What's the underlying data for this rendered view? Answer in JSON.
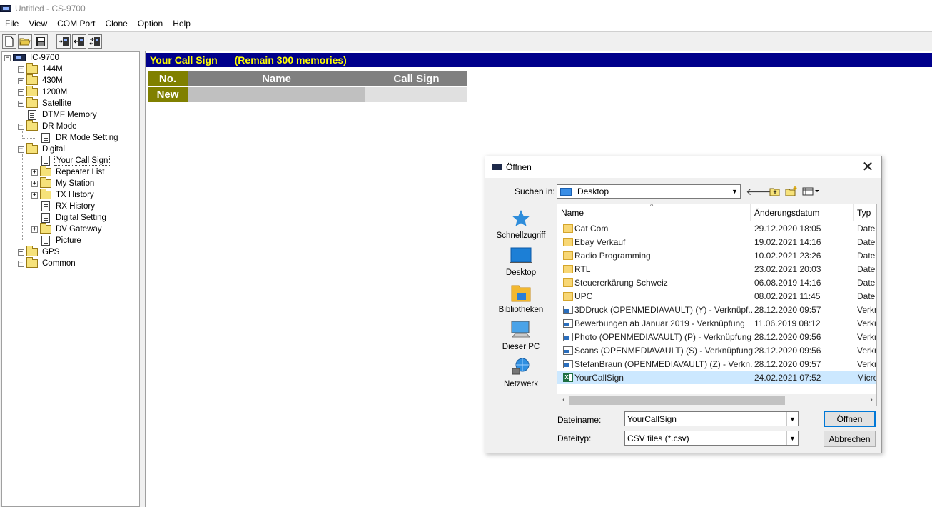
{
  "window": {
    "title": "Untitled - CS-9700"
  },
  "menu": [
    "File",
    "View",
    "COM Port",
    "Clone",
    "Option",
    "Help"
  ],
  "toolbar": {
    "buttons": [
      "new-file-icon",
      "open-folder-icon",
      "save-disk-icon",
      "write-to-radio-icon",
      "read-from-radio-icon",
      "clone-icon"
    ]
  },
  "tree": {
    "root": "IC-9700",
    "items": [
      "144M",
      "430M",
      "1200M",
      "Satellite",
      "DTMF Memory",
      "DR Mode",
      "DR Mode Setting",
      "Digital",
      "Your Call Sign",
      "Repeater List",
      "My Station",
      "TX History",
      "RX History",
      "Digital Setting",
      "DV Gateway",
      "Picture",
      "GPS",
      "Common"
    ]
  },
  "main": {
    "header_title": "Your Call Sign",
    "header_remain": "(Remain 300 memories)",
    "columns": [
      "No.",
      "Name",
      "Call Sign"
    ],
    "new_row_label": "New",
    "colors": {
      "header_bg": "#00008b",
      "header_text": "#ffff00",
      "col_head_bg": "#808080",
      "no_col_bg": "#808000"
    }
  },
  "dialog": {
    "title": "Öffnen",
    "look_in_label": "Suchen in:",
    "look_in_value": "Desktop",
    "places": [
      "Schnellzugriff",
      "Desktop",
      "Bibliotheken",
      "Dieser PC",
      "Netzwerk"
    ],
    "columns": [
      "Name",
      "Änderungsdatum",
      "Typ"
    ],
    "files": [
      {
        "name": "Cat Com",
        "date": "29.12.2020 18:05",
        "type": "Datei",
        "icon": "folder"
      },
      {
        "name": "Ebay Verkauf",
        "date": "19.02.2021 14:16",
        "type": "Datei",
        "icon": "folder"
      },
      {
        "name": "Radio Programming",
        "date": "10.02.2021 23:26",
        "type": "Datei",
        "icon": "folder"
      },
      {
        "name": "RTL",
        "date": "23.02.2021 20:03",
        "type": "Datei",
        "icon": "folder"
      },
      {
        "name": "Steuererkärung Schweiz",
        "date": "06.08.2019 14:16",
        "type": "Datei",
        "icon": "folder"
      },
      {
        "name": "UPC",
        "date": "08.02.2021 11:45",
        "type": "Datei",
        "icon": "folder"
      },
      {
        "name": "3DDruck (OPENMEDIAVAULT) (Y) - Verknüpf...",
        "date": "28.12.2020 09:57",
        "type": "Verkn",
        "icon": "link"
      },
      {
        "name": "Bewerbungen ab Januar 2019 - Verknüpfung",
        "date": "11.06.2019 08:12",
        "type": "Verkn",
        "icon": "link"
      },
      {
        "name": "Photo (OPENMEDIAVAULT) (P) - Verknüpfung",
        "date": "28.12.2020 09:56",
        "type": "Verkn",
        "icon": "link"
      },
      {
        "name": "Scans (OPENMEDIAVAULT) (S) - Verknüpfung",
        "date": "28.12.2020 09:56",
        "type": "Verkn",
        "icon": "link"
      },
      {
        "name": "StefanBraun (OPENMEDIAVAULT) (Z) - Verkn...",
        "date": "28.12.2020 09:57",
        "type": "Verkn",
        "icon": "link"
      },
      {
        "name": "YourCallSign",
        "date": "24.02.2021 07:52",
        "type": "Micro",
        "icon": "xls"
      }
    ],
    "filename_label": "Dateiname:",
    "filename_value": "YourCallSign",
    "filetype_label": "Dateityp:",
    "filetype_value": "CSV files (*.csv)",
    "open_button": "Öffnen",
    "cancel_button": "Abbrechen"
  }
}
